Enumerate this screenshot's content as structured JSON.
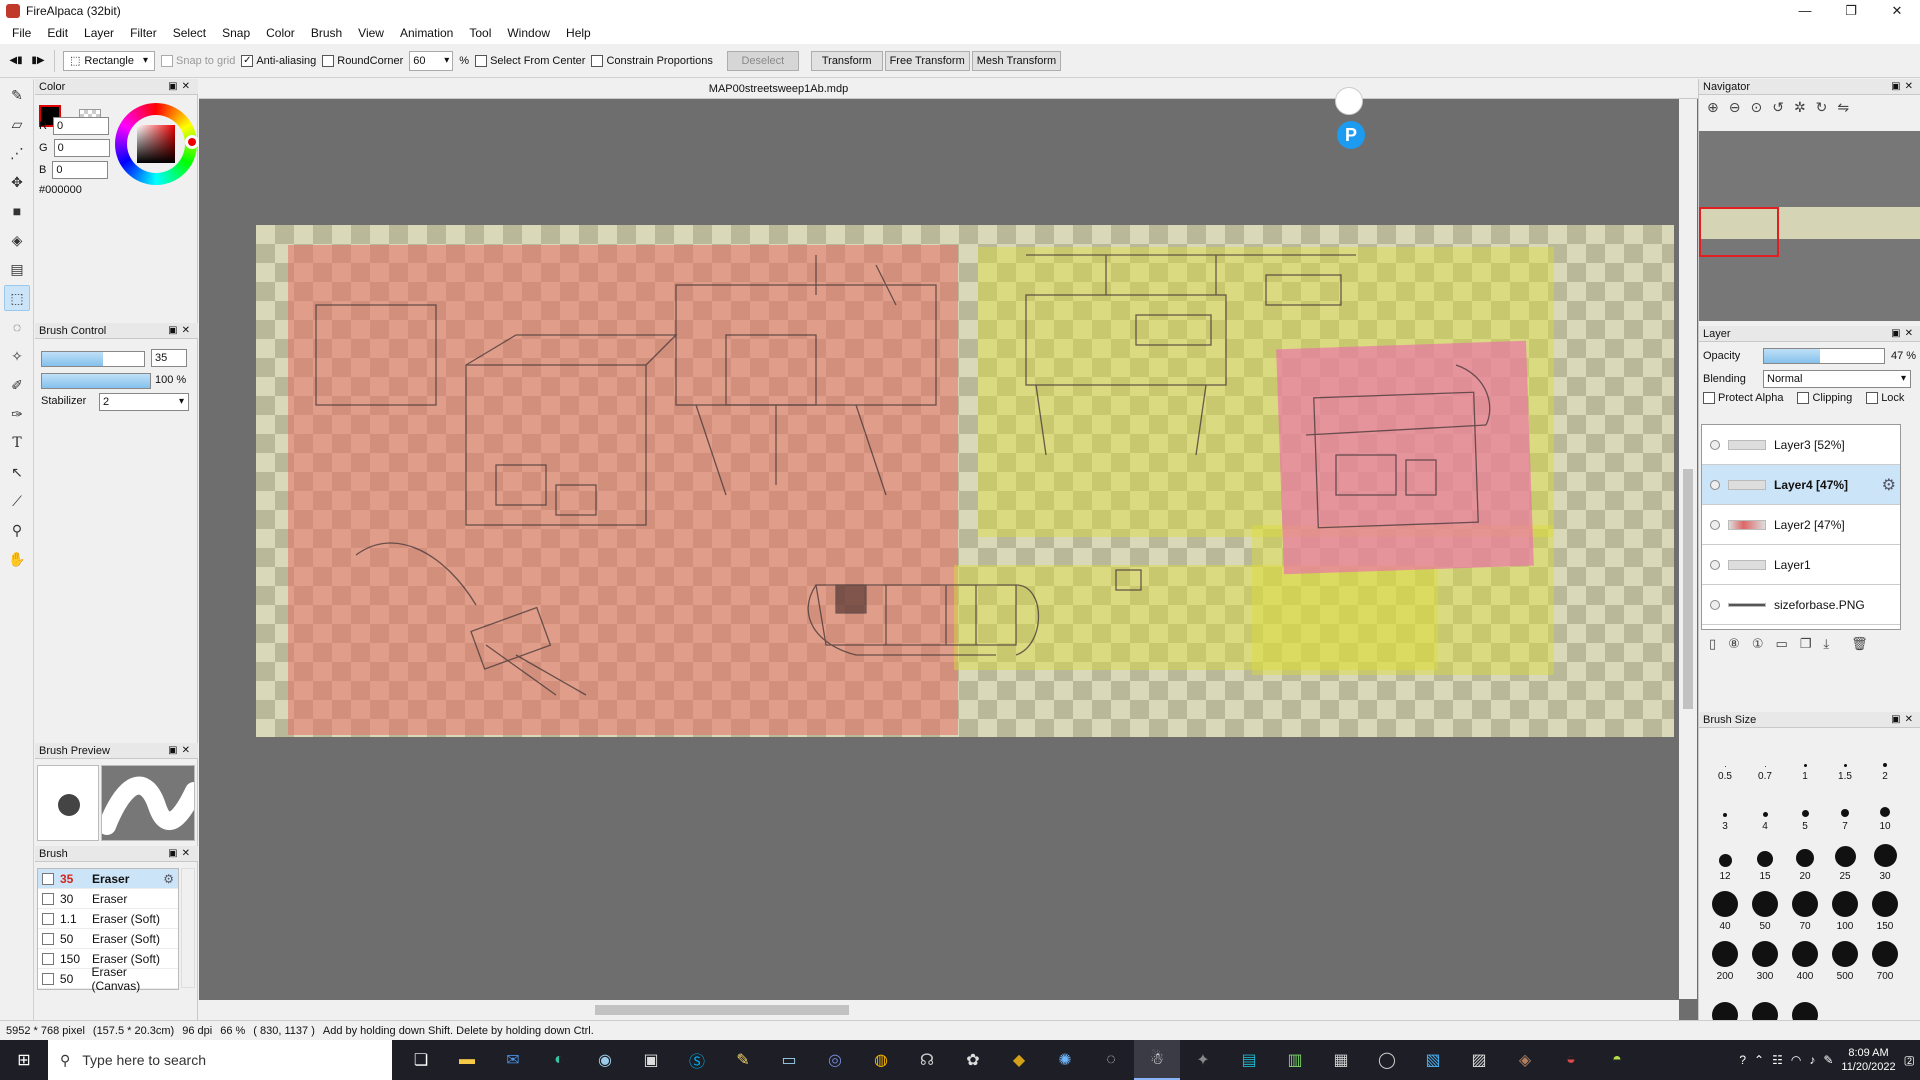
{
  "window": {
    "title": "FireAlpaca (32bit)",
    "minimize": "—",
    "maximize": "❐",
    "close": "✕"
  },
  "menu": [
    "File",
    "Edit",
    "Layer",
    "Filter",
    "Select",
    "Snap",
    "Color",
    "Brush",
    "View",
    "Animation",
    "Tool",
    "Window",
    "Help"
  ],
  "options": {
    "tool_mode": "Rectangle",
    "snap_to_grid": "Snap to grid",
    "anti_aliasing": "Anti-aliasing",
    "round_corner": "RoundCorner",
    "corner_value": "60",
    "percent": "%",
    "select_from_center": "Select From Center",
    "constrain_proportions": "Constrain Proportions",
    "deselect": "Deselect",
    "transform": "Transform",
    "free_transform": "Free Transform",
    "mesh_transform": "Mesh Transform"
  },
  "color_panel": {
    "title": "Color",
    "r_label": "R",
    "g_label": "G",
    "b_label": "B",
    "r": "0",
    "g": "0",
    "b": "0",
    "hex": "#000000",
    "fg_color": "#000000"
  },
  "brush_control": {
    "title": "Brush Control",
    "size": "35",
    "size_fraction": 0.6,
    "opacity": "100 %",
    "opacity_fraction": 1.0,
    "stabilizer_label": "Stabilizer",
    "stabilizer": "2"
  },
  "brush_preview": {
    "title": "Brush Preview"
  },
  "brush_panel": {
    "title": "Brush",
    "items": [
      {
        "size": "35",
        "name": "Eraser",
        "selected": true
      },
      {
        "size": "30",
        "name": "Eraser",
        "selected": false
      },
      {
        "size": "1.1",
        "name": "Eraser (Soft)",
        "selected": false
      },
      {
        "size": "50",
        "name": "Eraser (Soft)",
        "selected": false
      },
      {
        "size": "150",
        "name": "Eraser (Soft)",
        "selected": false
      },
      {
        "size": "50",
        "name": "Eraser (Canvas)",
        "selected": false
      }
    ]
  },
  "document": {
    "tab": "MAP00streetsweep1Ab.mdp"
  },
  "navigator": {
    "title": "Navigator"
  },
  "layer_panel": {
    "title": "Layer",
    "opacity_label": "Opacity",
    "opacity": "47 %",
    "opacity_fraction": 0.47,
    "blending_label": "Blending",
    "blending": "Normal",
    "protect_alpha": "Protect Alpha",
    "clipping": "Clipping",
    "lock": "Lock",
    "layers": [
      {
        "name": "Layer3 [52%]",
        "selected": false
      },
      {
        "name": "Layer4 [47%]",
        "selected": true
      },
      {
        "name": "Layer2 [47%]",
        "selected": false
      },
      {
        "name": "Layer1",
        "selected": false
      },
      {
        "name": "sizeforbase.PNG",
        "selected": false
      }
    ]
  },
  "brush_size": {
    "title": "Brush Size",
    "sizes": [
      "0.5",
      "0.7",
      "1",
      "1.5",
      "2",
      "3",
      "4",
      "5",
      "7",
      "10",
      "12",
      "15",
      "20",
      "25",
      "30",
      "40",
      "50",
      "70",
      "100",
      "150",
      "200",
      "300",
      "400",
      "500",
      "700",
      "",
      "",
      ""
    ]
  },
  "status": {
    "dimensions": "5952 * 768 pixel",
    "physical": "(157.5 * 20.3cm)",
    "dpi": "96 dpi",
    "zoom": "66 %",
    "cursor": "( 830, 1137 )",
    "hint": "Add by holding down Shift. Delete by holding down Ctrl."
  },
  "taskbar": {
    "search_placeholder": "Type here to search",
    "time": "8:09 AM",
    "date": "11/20/2022",
    "notifications": "2"
  }
}
